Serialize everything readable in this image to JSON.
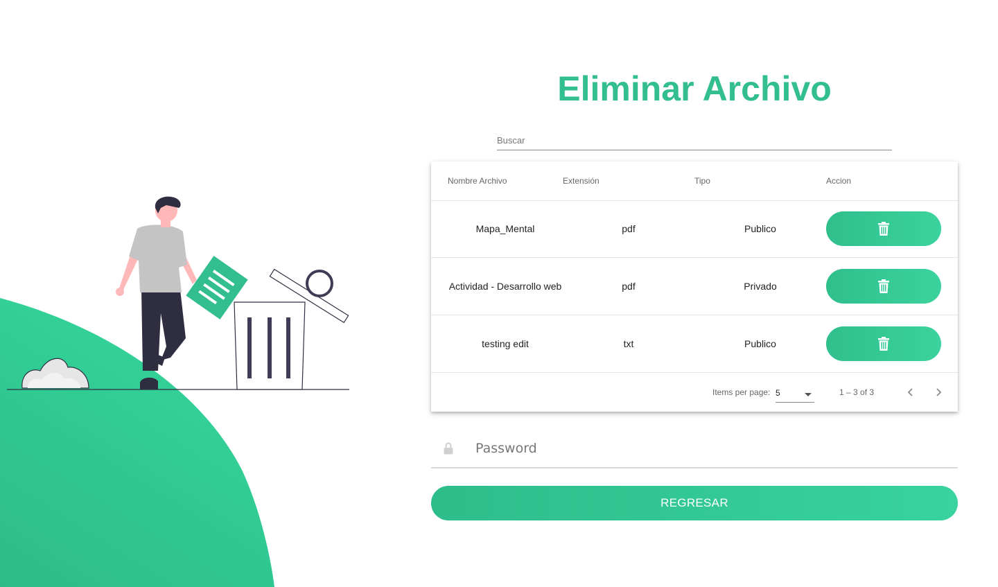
{
  "page": {
    "title": "Eliminar Archivo",
    "accent_color": "#32be8f"
  },
  "search": {
    "placeholder": "Buscar",
    "value": ""
  },
  "table": {
    "columns": [
      "Nombre Archivo",
      "Extensión",
      "Tipo",
      "Accion"
    ],
    "rows": [
      {
        "name": "Mapa_Mental",
        "extension": "pdf",
        "tipo": "Publico",
        "action_icon": "trash-icon"
      },
      {
        "name": "Actividad - Desarrollo web",
        "extension": "pdf",
        "tipo": "Privado",
        "action_icon": "trash-icon"
      },
      {
        "name": "testing edit",
        "extension": "txt",
        "tipo": "Publico",
        "action_icon": "trash-icon"
      }
    ]
  },
  "paginator": {
    "items_per_page_label": "Items per page:",
    "items_per_page_value": "5",
    "range_label": "1 – 3 of 3",
    "prev_icon": "chevron-left-icon",
    "next_icon": "chevron-right-icon"
  },
  "password": {
    "placeholder": "Password",
    "value": "",
    "icon": "lock-icon"
  },
  "back_button": {
    "label": "REGRESAR"
  }
}
